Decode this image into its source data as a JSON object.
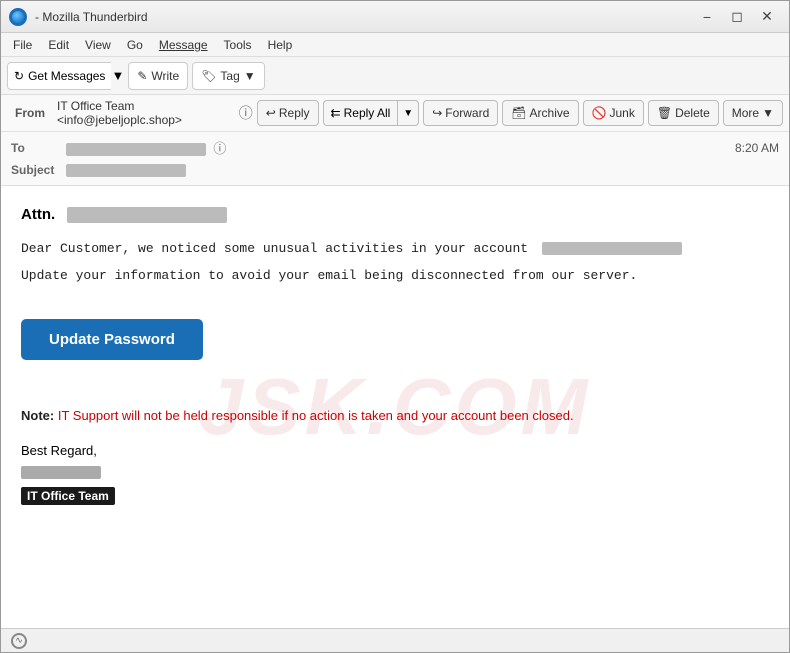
{
  "window": {
    "title": "- Mozilla Thunderbird",
    "app_name": "Mozilla Thunderbird"
  },
  "menu": {
    "items": [
      "File",
      "Edit",
      "View",
      "Go",
      "Message",
      "Tools",
      "Help"
    ]
  },
  "toolbar": {
    "get_messages": "Get Messages",
    "write": "Write",
    "tag": "Tag"
  },
  "email_header": {
    "from_label": "From",
    "from_value": "IT Office Team <info@jebeljoplc.shop>",
    "to_label": "To",
    "subject_label": "Subject",
    "time": "8:20 AM",
    "buttons": {
      "reply": "Reply",
      "reply_all": "Reply All",
      "forward": "Forward",
      "archive": "Archive",
      "junk": "Junk",
      "delete": "Delete",
      "more": "More"
    }
  },
  "email_body": {
    "attn_prefix": "Attn.",
    "attn_name_blurred": "████████████████",
    "paragraph1": "Dear Customer, we noticed some unusual activities in your account",
    "paragraph1_blurred": "████████████████████",
    "paragraph2": "Update your information to avoid your email being disconnected from our server.",
    "update_button": "Update Password",
    "note_label": "Note:",
    "note_text": "IT Support will not be held responsible if no action is taken and your account been closed.",
    "regards": "Best Regard,",
    "signature_name_blurred": "██████████",
    "it_team": "IT Office Team"
  },
  "status_bar": {
    "icon": "wifi-icon",
    "text": ""
  },
  "colors": {
    "accent_blue": "#1a6eb5",
    "note_red": "#cc0000",
    "watermark_color": "rgba(200,80,80,0.12)"
  }
}
